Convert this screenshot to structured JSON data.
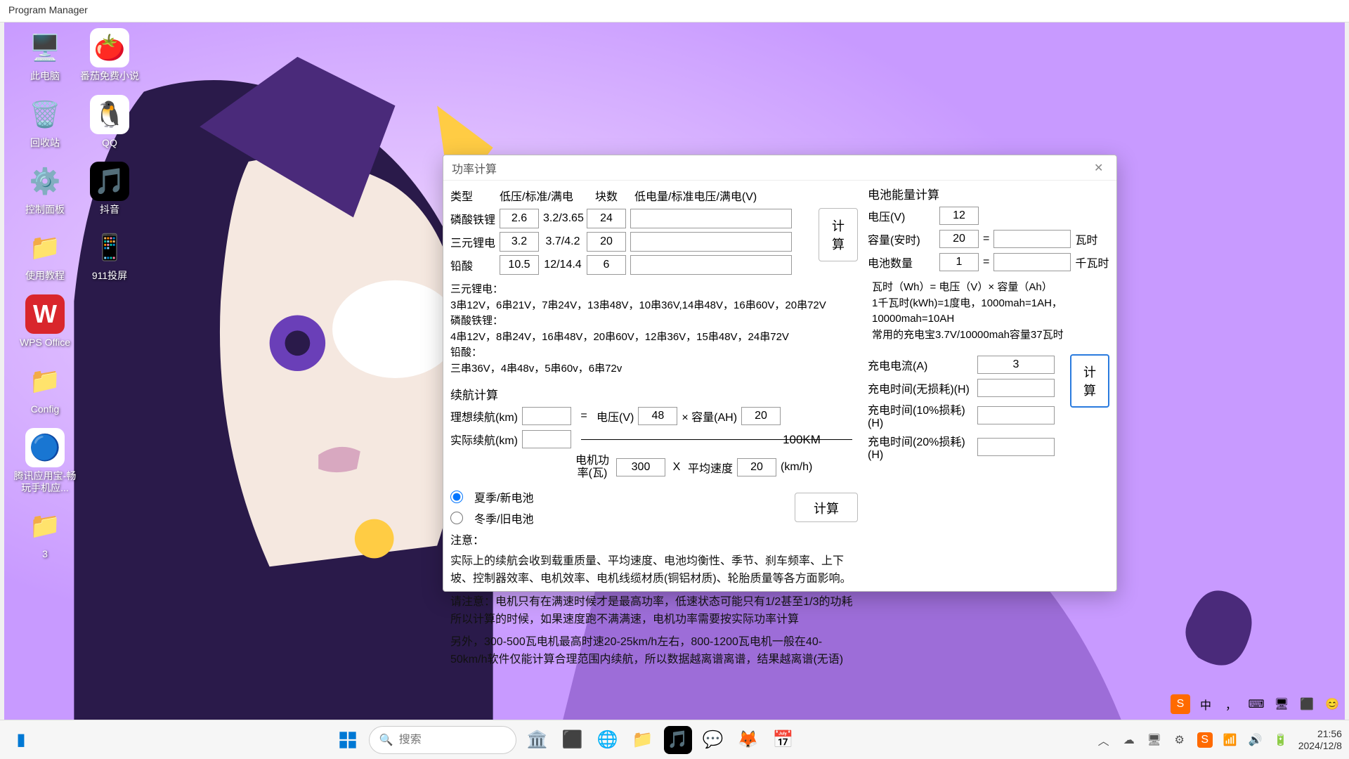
{
  "titlebar": {
    "text": "Program Manager"
  },
  "icons": [
    {
      "label": "此电脑",
      "emoji": "🖥️",
      "bg": ""
    },
    {
      "label": "番茄免费小说",
      "emoji": "🍅",
      "bg": "#fff"
    },
    {
      "label": "回收站",
      "emoji": "🗑️",
      "bg": ""
    },
    {
      "label": "QQ",
      "emoji": "🐧",
      "bg": "#fff"
    },
    {
      "label": "控制面板",
      "emoji": "⚙️",
      "bg": ""
    },
    {
      "label": "抖音",
      "emoji": "🎵",
      "bg": "#000"
    },
    {
      "label": "使用教程",
      "emoji": "📁",
      "bg": ""
    },
    {
      "label": "911投屏",
      "emoji": "📱",
      "bg": ""
    },
    {
      "label": "WPS Office",
      "emoji": "W",
      "bg": "#d9262c"
    },
    {
      "label": "",
      "emoji": "",
      "bg": ""
    },
    {
      "label": "Config",
      "emoji": "📁",
      "bg": ""
    },
    {
      "label": "",
      "emoji": "",
      "bg": ""
    },
    {
      "label": "腾讯应用宝-畅玩手机应...",
      "emoji": "🔵",
      "bg": "#fff"
    },
    {
      "label": "",
      "emoji": "",
      "bg": ""
    },
    {
      "label": "3",
      "emoji": "📁",
      "bg": ""
    }
  ],
  "dialog": {
    "title": "功率计算",
    "headers": {
      "type": "类型",
      "lsf": "低压/标准/满电",
      "qty": "块数",
      "lsfv": "低电量/标准电压/满电(V)"
    },
    "rows": [
      {
        "name": "磷酸铁锂",
        "v": "2.6",
        "std": "3.2/3.65",
        "qty": "24"
      },
      {
        "name": "三元锂电",
        "v": "3.2",
        "std": "3.7/4.2",
        "qty": "20"
      },
      {
        "name": "铅酸",
        "v": "10.5",
        "std": "12/14.4",
        "qty": "6"
      }
    ],
    "calc_btn": "计算",
    "series_text": "三元锂电：\n3串12V，6串21V，7串24V，13串48V，10串36V,14串48V，16串60V，20串72V\n磷酸铁锂：\n4串12V，8串24V，16串48V，20串60V，12串36V，15串48V，24串72V\n铅酸：\n三串36V，4串48v，5串60v，6串72v",
    "range": {
      "title": "续航计算",
      "ideal_lbl": "理想续航(km)",
      "eq": "=",
      "volt_lbl": "电压(V)",
      "volt": "48",
      "cap_lbl": "× 容量(AH)",
      "cap": "20",
      "real_lbl": "实际续航(km)",
      "per": "100KM",
      "motor_lbl": "电机功率(瓦)",
      "motor": "300",
      "x": "X",
      "avg_lbl": "平均速度",
      "avg": "20",
      "avg_unit": "(km/h)",
      "r1": "夏季/新电池",
      "r2": "冬季/旧电池",
      "btn": "计算",
      "note_lbl": "注意：",
      "note1": "实际上的续航会收到载重质量、平均速度、电池均衡性、季节、刹车频率、上下坡、控制器效率、电机效率、电机线缆材质(铜铝材质)、轮胎质量等各方面影响。",
      "note2": "请注意：电机只有在满速时候才是最高功率，低速状态可能只有1/2甚至1/3的功耗所以计算的时候，如果速度跑不满满速，电机功率需要按实际功率计算",
      "note3": "另外，300-500瓦电机最高时速20-25km/h左右，800-1200瓦电机一般在40-50km/h软件仅能计算合理范围内续航，所以数据越离谱离谱，结果越离谱(无语)"
    },
    "energy": {
      "title": "电池能量计算",
      "volt_lbl": "电压(V)",
      "volt": "12",
      "cap_lbl": "容量(安时)",
      "cap": "20",
      "eq": "=",
      "wh": "瓦时",
      "cnt_lbl": "电池数量",
      "cnt": "1",
      "kwh": "千瓦时",
      "formula": "瓦时（Wh）= 电压（V）× 容量（Ah）\n1千瓦时(kWh)=1度电，1000mah=1AH，10000mah=10AH\n常用的充电宝3.7V/10000mah容量37瓦时",
      "cur_lbl": "充电电流(A)",
      "cur": "3",
      "t0_lbl": "充电时间(无损耗)(H)",
      "t1_lbl": "充电时间(10%损耗)(H)",
      "t2_lbl": "充电时间(20%损耗)(H)",
      "btn": "计算"
    }
  },
  "taskbar": {
    "search_ph": "搜索",
    "time": "21:56",
    "date": "2024/12/8",
    "apps": [
      "🏛️",
      "⬛",
      "🌐",
      "📁",
      "🎵",
      "💬",
      "🦊",
      "📅"
    ]
  },
  "ime": [
    "中",
    "，",
    "⌨",
    "🖥",
    "⬛",
    "😊"
  ]
}
